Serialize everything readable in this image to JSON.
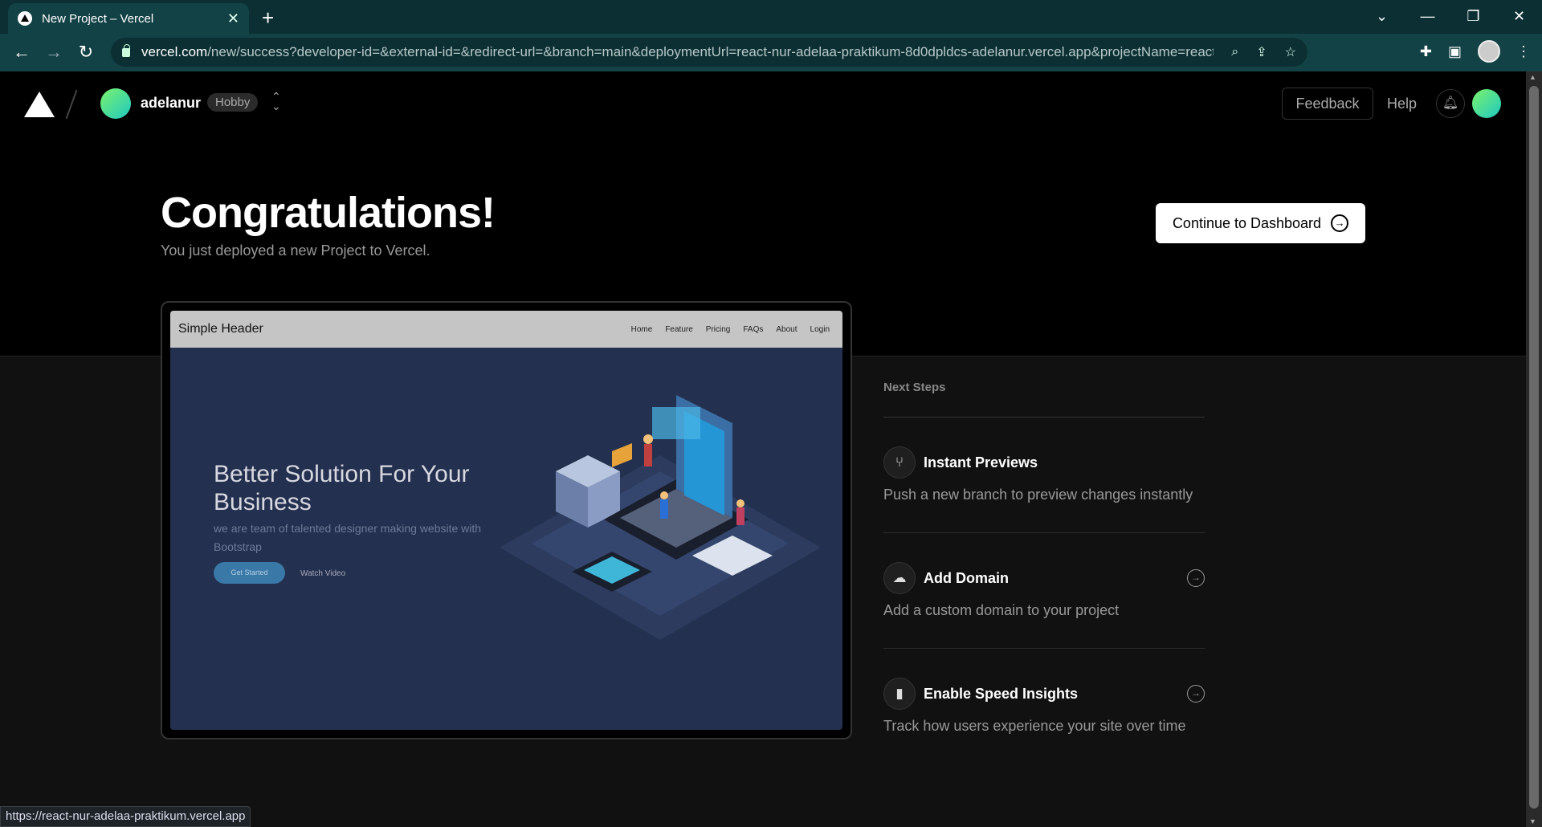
{
  "browser": {
    "tab_title": "New Project – Vercel",
    "url_host": "vercel.com",
    "url_path": "/new/success?developer-id=&external-id=&redirect-url=&branch=main&deploymentUrl=react-nur-adelaa-praktikum-8d0dpldcs-adelanur.vercel.app&projectName=react-n...",
    "status_url": "https://react-nur-adelaa-praktikum.vercel.app"
  },
  "header": {
    "username": "adelanur",
    "plan": "Hobby",
    "feedback": "Feedback",
    "help": "Help"
  },
  "hero": {
    "title": "Congratulations!",
    "subtitle": "You just deployed a new Project to Vercel.",
    "continue": "Continue to Dashboard"
  },
  "preview": {
    "brand": "Simple Header",
    "nav": [
      "Home",
      "Feature",
      "Pricing",
      "FAQs",
      "About",
      "Login"
    ],
    "hero_title": "Better Solution For Your Business",
    "hero_sub": "we are team of talented designer making website with Bootstrap",
    "cta": "Get Started",
    "watch": "Watch Video"
  },
  "next_steps": {
    "label": "Next Steps",
    "items": [
      {
        "title": "Instant Previews",
        "desc": "Push a new branch to preview changes instantly",
        "icon": "branch-icon"
      },
      {
        "title": "Add Domain",
        "desc": "Add a custom domain to your project",
        "icon": "cloud-icon"
      },
      {
        "title": "Enable Speed Insights",
        "desc": "Track how users experience your site over time",
        "icon": "bar-chart-icon"
      }
    ]
  },
  "colors": {
    "chrome": "#134246",
    "accent_gradient_start": "#7cf26b",
    "accent_gradient_end": "#1ec9c2",
    "preview_bg": "#23304f"
  }
}
